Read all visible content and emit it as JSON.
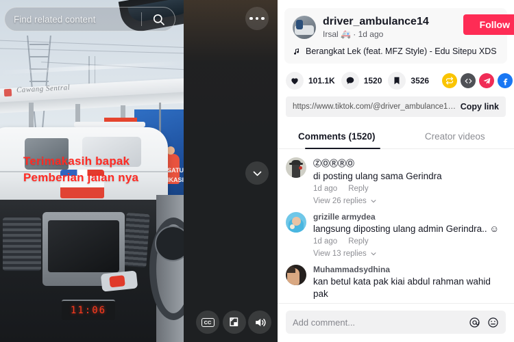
{
  "video": {
    "search_placeholder": "Find related content",
    "search_icon": "search-icon",
    "more_icon": "more-options-icon",
    "next_icon": "chevron-down-icon",
    "overlay_caption_line1": "Terimakasih bapak",
    "overlay_caption_line2": "Pemberian jalan nya",
    "station_sign": "Cawang Sentral",
    "billboard_text_line1": "TU SATU",
    "billboard_text_line2": "IKASI",
    "dash_clock": "11:06",
    "controls": [
      {
        "name": "captions-button",
        "label": "CC"
      },
      {
        "name": "picture-in-picture-button",
        "label": ""
      },
      {
        "name": "volume-button",
        "label": ""
      }
    ]
  },
  "author": {
    "username": "driver_ambulance14",
    "nickname": "Irsal 🚑 · 1d ago",
    "follow_label": "Follow",
    "music_icon": "music-note-icon",
    "music": "Berangkat Lek (feat. MFZ Style) - Edu Sitepu XDS"
  },
  "stats": [
    {
      "name": "like",
      "icon": "heart-icon",
      "value": "101.1K"
    },
    {
      "name": "comment",
      "icon": "comment-icon",
      "value": "1520"
    },
    {
      "name": "bookmark",
      "icon": "bookmark-icon",
      "value": "3526"
    }
  ],
  "share": [
    {
      "name": "repost-icon",
      "color": "#fac400"
    },
    {
      "name": "embed-code-icon",
      "color": "#4f5156"
    },
    {
      "name": "telegram-icon",
      "color": "#f02c56"
    },
    {
      "name": "facebook-icon",
      "color": "#1977f3"
    },
    {
      "name": "whatsapp-icon",
      "color": "#25d366"
    }
  ],
  "link": {
    "url": "https://www.tiktok.com/@driver_ambulance14/video/7…",
    "copy_label": "Copy link"
  },
  "tabs": [
    {
      "label": "Comments (1520)",
      "active": true
    },
    {
      "label": "Creator videos",
      "active": false
    }
  ],
  "comments": [
    {
      "name": "ⓏⓄⓇⓇⓄ",
      "text": "di posting ulang sama Gerindra",
      "time": "1d ago",
      "reply": "Reply",
      "replies": "View 26 replies"
    },
    {
      "name": "grizille armydea",
      "text": "langsung diposting ulang admin Gerindra.. ☺",
      "time": "1d ago",
      "reply": "Reply",
      "replies": "View 13 replies"
    },
    {
      "name": "Muhammadsydhina",
      "text": "kan betul kata pak kiai abdul rahman wahid pak",
      "time": "",
      "reply": "",
      "replies": ""
    }
  ],
  "composer": {
    "placeholder": "Add comment...",
    "mention_icon": "at-mention-icon",
    "emoji_icon": "emoji-icon"
  }
}
